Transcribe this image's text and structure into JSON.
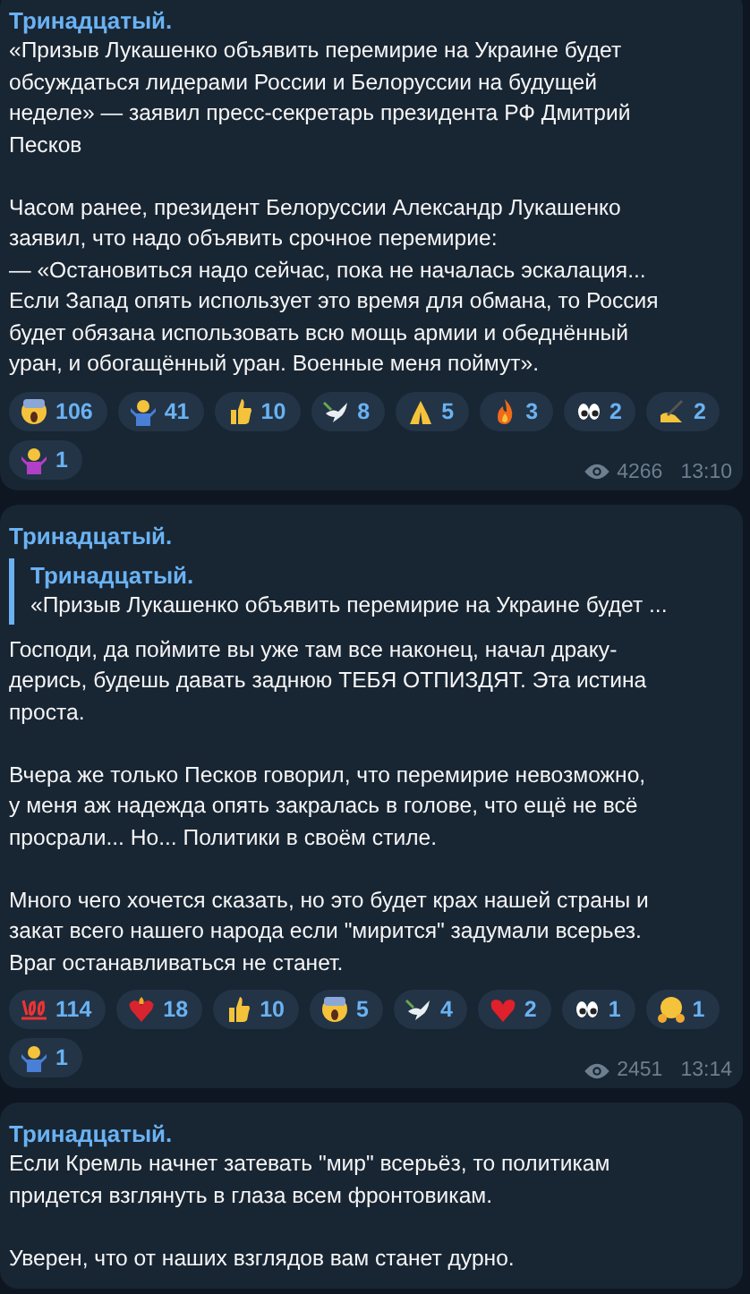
{
  "messages": [
    {
      "author": "Тринадцатый.",
      "paragraphs": [
        "«Призыв Лукашенко объявить перемирие на Украине будет\nобсуждаться лидерами России и Белоруссии на будущей\nнеделе» — заявил пресс-секретарь президента РФ Дмитрий\nПесков",
        "Часом ранее, президент Белоруссии Александр Лукашенко\nзаявил, что надо объявить срочное перемирие:\n— «Остановиться надо сейчас, пока не началась эскалация...\nЕсли Запад опять использует это время для обмана, то Россия\nбудет обязана использовать всю мощь армии и обеднённый\nуран, и обогащённый уран. Военные меня поймут»."
      ],
      "reactions": [
        {
          "kind": "scream",
          "count": "106"
        },
        {
          "kind": "shrug-man",
          "count": "41"
        },
        {
          "kind": "thumbs-up",
          "count": "10"
        },
        {
          "kind": "dove",
          "count": "8"
        },
        {
          "kind": "pray",
          "count": "5"
        },
        {
          "kind": "fire",
          "count": "3"
        },
        {
          "kind": "eyes",
          "count": "2"
        },
        {
          "kind": "writing",
          "count": "2"
        },
        {
          "kind": "shrug-woman",
          "count": "1"
        }
      ],
      "views": "4266",
      "time": "13:10"
    },
    {
      "author": "Тринадцатый.",
      "quote": {
        "author": "Тринадцатый.",
        "text": "«Призыв Лукашенко объявить перемирие на Украине будет ..."
      },
      "paragraphs": [
        "Господи, да поймите вы уже там все наконец, начал драку-\nдерись, будешь давать заднюю ТЕБЯ ОТПИЗДЯТ. Эта истина\nпроста.",
        "Вчера же только Песков говорил, что перемирие невозможно,\nу меня аж надежда опять закралась в голове, что ещё не всё\nпросрали...  Но... Политики в своём стиле.",
        "Много чего хочется сказать, но это будет крах нашей страны и\nзакат всего нашего народа если \"мирится\" задумали всерьез.\nВраг останавливаться не станет."
      ],
      "reactions": [
        {
          "kind": "hundred",
          "count": "114"
        },
        {
          "kind": "heart-fire",
          "count": "18"
        },
        {
          "kind": "thumbs-up",
          "count": "10"
        },
        {
          "kind": "scream",
          "count": "5"
        },
        {
          "kind": "dove",
          "count": "4"
        },
        {
          "kind": "heart",
          "count": "2"
        },
        {
          "kind": "eyes",
          "count": "1"
        },
        {
          "kind": "hug",
          "count": "1"
        },
        {
          "kind": "shrug-man",
          "count": "1"
        }
      ],
      "views": "2451",
      "time": "13:14"
    },
    {
      "author": "Тринадцатый.",
      "paragraphs": [
        "Если Кремль начнет затевать \"мир\" всерьёз, то политикам\nпридется взглянуть в глаза всем фронтовикам.",
        "Уверен, что от наших взглядов вам станет дурно."
      ]
    }
  ]
}
